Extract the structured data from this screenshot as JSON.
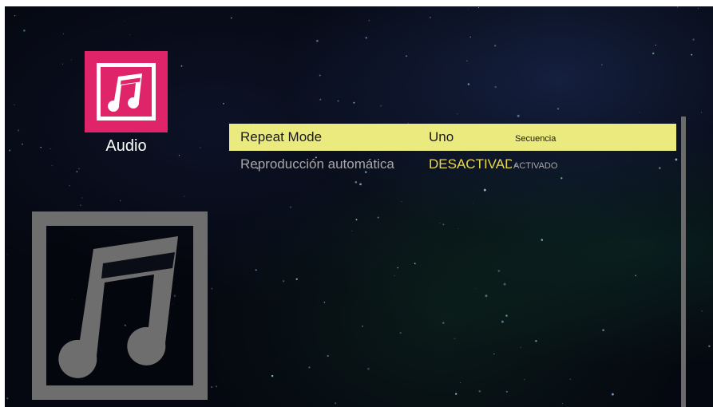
{
  "category": {
    "label": "Audio",
    "icon": "music-note-icon",
    "tile_color": "#e0246a"
  },
  "preview": {
    "icon": "music-note-icon",
    "frame_color": "#6e6e6e"
  },
  "settings": [
    {
      "label": "Repeat Mode",
      "value": "Uno",
      "next_option": "Secuencia",
      "selected": true
    },
    {
      "label": "Reproducción automática",
      "value": "DESACTIVADO",
      "next_option": "ACTIVADO",
      "selected": false
    }
  ],
  "colors": {
    "highlight": "#eaea7e",
    "value_text": "#e8d84a",
    "muted_text": "#a8a8a8",
    "background": "#050810"
  }
}
